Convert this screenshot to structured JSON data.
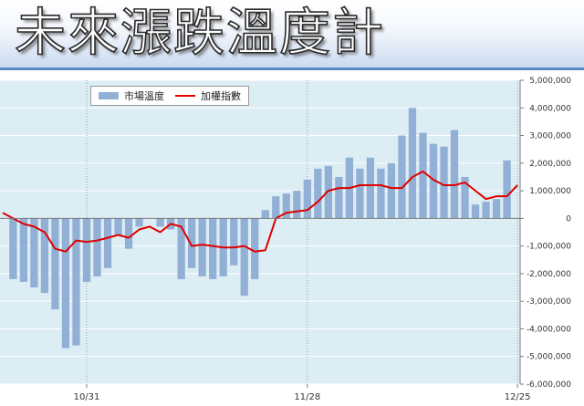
{
  "header": {
    "title": "未來漲跌溫度計"
  },
  "colors": {
    "bars": "#92b0d6",
    "line": "#e00000",
    "plot_bg": "#dcedf4",
    "grid": "#ffffff"
  },
  "chart_data": {
    "type": "bar",
    "title": "",
    "legend": {
      "placement": "top-left"
    },
    "categories": [
      "",
      "",
      "",
      "",
      "",
      "",
      "",
      "",
      "10/31",
      "",
      "",
      "",
      "",
      "",
      "",
      "",
      "",
      "",
      "",
      "",
      "",
      "",
      "",
      "",
      "",
      "",
      "",
      "",
      "",
      "11/28",
      "",
      "",
      "",
      "",
      "",
      "",
      "",
      "",
      "",
      "",
      "",
      "",
      "",
      "",
      "",
      "",
      "",
      "",
      "",
      "12/25"
    ],
    "x_tick_labels": [
      "10/31",
      "11/28",
      "12/25"
    ],
    "series": [
      {
        "name": "市場溫度",
        "type": "bar",
        "values": [
          0,
          -2200000,
          -2300000,
          -2500000,
          -2700000,
          -3300000,
          -4700000,
          -4600000,
          -2300000,
          -2100000,
          -1800000,
          -600000,
          -1100000,
          -300000,
          0,
          -300000,
          -400000,
          -2200000,
          -1800000,
          -2100000,
          -2200000,
          -2100000,
          -1700000,
          -2800000,
          -2200000,
          300000,
          800000,
          900000,
          1000000,
          1400000,
          1800000,
          1900000,
          1500000,
          2200000,
          1800000,
          2200000,
          1800000,
          2000000,
          3000000,
          4000000,
          3100000,
          2700000,
          2600000,
          3200000,
          1500000,
          500000,
          600000,
          700000,
          2100000,
          0
        ]
      },
      {
        "name": "加權指數",
        "type": "line",
        "values": [
          200000,
          0,
          -200000,
          -300000,
          -500000,
          -1100000,
          -1200000,
          -800000,
          -850000,
          -800000,
          -700000,
          -600000,
          -700000,
          -400000,
          -300000,
          -500000,
          -200000,
          -300000,
          -1000000,
          -950000,
          -1000000,
          -1050000,
          -1050000,
          -1000000,
          -1200000,
          -1150000,
          0,
          200000,
          250000,
          300000,
          600000,
          1000000,
          1100000,
          1100000,
          1200000,
          1200000,
          1200000,
          1100000,
          1100000,
          1500000,
          1700000,
          1400000,
          1200000,
          1200000,
          1300000,
          1000000,
          700000,
          800000,
          800000,
          1200000
        ]
      }
    ],
    "ylim": [
      -6000000,
      5000000
    ],
    "y_ticks": [
      "-6,000,000",
      "-5,000,000",
      "-4,000,000",
      "-3,000,000",
      "-2,000,000",
      "-1,000,000",
      "0",
      "1,000,000",
      "2,000,000",
      "3,000,000",
      "4,000,000",
      "5,000,000"
    ],
    "grid": true
  }
}
